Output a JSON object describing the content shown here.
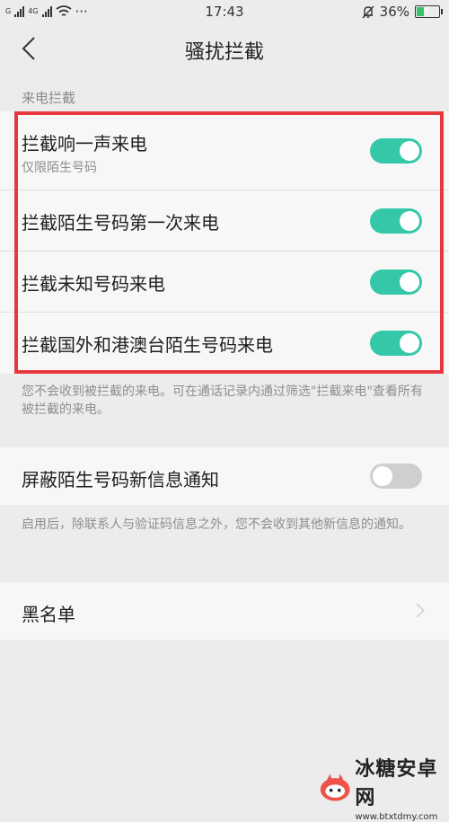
{
  "status_bar": {
    "carrier_tags": [
      "G",
      "4G"
    ],
    "more": "···",
    "time": "17:43",
    "battery_text": "36%",
    "battery_level": 0.36
  },
  "header": {
    "title": "骚扰拦截"
  },
  "call_section": {
    "label": "来电拦截",
    "items": [
      {
        "title": "拦截响一声来电",
        "subtitle": "仅限陌生号码",
        "enabled": true
      },
      {
        "title": "拦截陌生号码第一次来电",
        "enabled": true
      },
      {
        "title": "拦截未知号码来电",
        "enabled": true
      },
      {
        "title": "拦截国外和港澳台陌生号码来电",
        "enabled": true
      }
    ],
    "note": "您不会收到被拦截的来电。可在通话记录内通过筛选\"拦截来电\"查看所有被拦截的来电。"
  },
  "sms_section": {
    "title": "屏蔽陌生号码新信息通知",
    "enabled": false,
    "note": "启用后，除联系人与验证码信息之外，您不会收到其他新信息的通知。"
  },
  "blacklist": {
    "label": "黑名单"
  },
  "watermark": {
    "name": "冰糖安卓网",
    "url": "www.btxtdmy.com"
  },
  "colors": {
    "toggle_on": "#35c8a8",
    "toggle_off": "#cfcfcf",
    "highlight": "#e8383d"
  }
}
